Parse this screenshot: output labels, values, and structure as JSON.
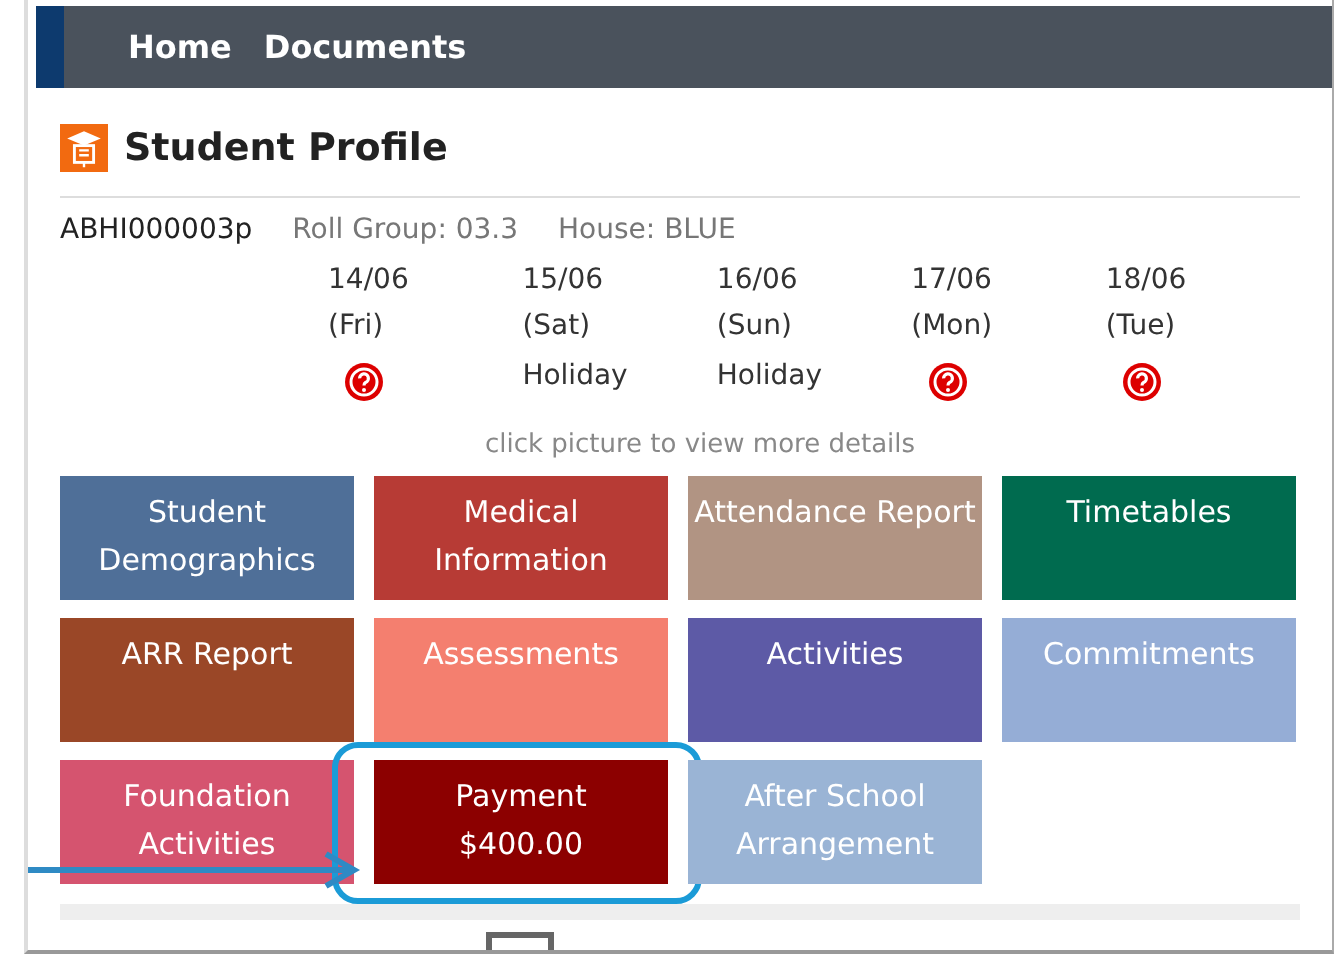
{
  "nav": {
    "items": [
      "Home",
      "Documents"
    ]
  },
  "profile": {
    "title": "Student Profile",
    "id": "ABHI000003p",
    "roll_group": "Roll Group: 03.3",
    "house": "House: BLUE"
  },
  "days": [
    {
      "date": "14/06",
      "day": "(Fri)",
      "kind": "icon"
    },
    {
      "date": "15/06",
      "day": "(Sat)",
      "kind": "text",
      "status": "Holiday"
    },
    {
      "date": "16/06",
      "day": "(Sun)",
      "kind": "text",
      "status": "Holiday"
    },
    {
      "date": "17/06",
      "day": "(Mon)",
      "kind": "icon"
    },
    {
      "date": "18/06",
      "day": "(Tue)",
      "kind": "icon"
    }
  ],
  "hint": "click picture to view more details",
  "tiles": [
    {
      "label": "Student Demographics",
      "color": "#4f6f98",
      "highlighted": false
    },
    {
      "label": "Medical Information",
      "color": "#b73b35",
      "highlighted": false
    },
    {
      "label": "Attendance Report",
      "color": "#b19483",
      "highlighted": false
    },
    {
      "label": "Timetables",
      "color": "#006b4f",
      "highlighted": false
    },
    {
      "label": "ARR Report",
      "color": "#9a4727",
      "highlighted": false
    },
    {
      "label": "Assessments",
      "color": "#f47f6f",
      "highlighted": false
    },
    {
      "label": "Activities",
      "color": "#5d5aa6",
      "highlighted": false
    },
    {
      "label": "Commitments",
      "color": "#95add6",
      "highlighted": false
    },
    {
      "label": "Foundation Activities",
      "color": "#d5546f",
      "highlighted": false
    },
    {
      "label": "Payment",
      "amount": "$400.00",
      "color": "#8c0000",
      "highlighted": true
    },
    {
      "label": "After School Arrangement",
      "color": "#9ab4d5",
      "highlighted": false
    }
  ]
}
